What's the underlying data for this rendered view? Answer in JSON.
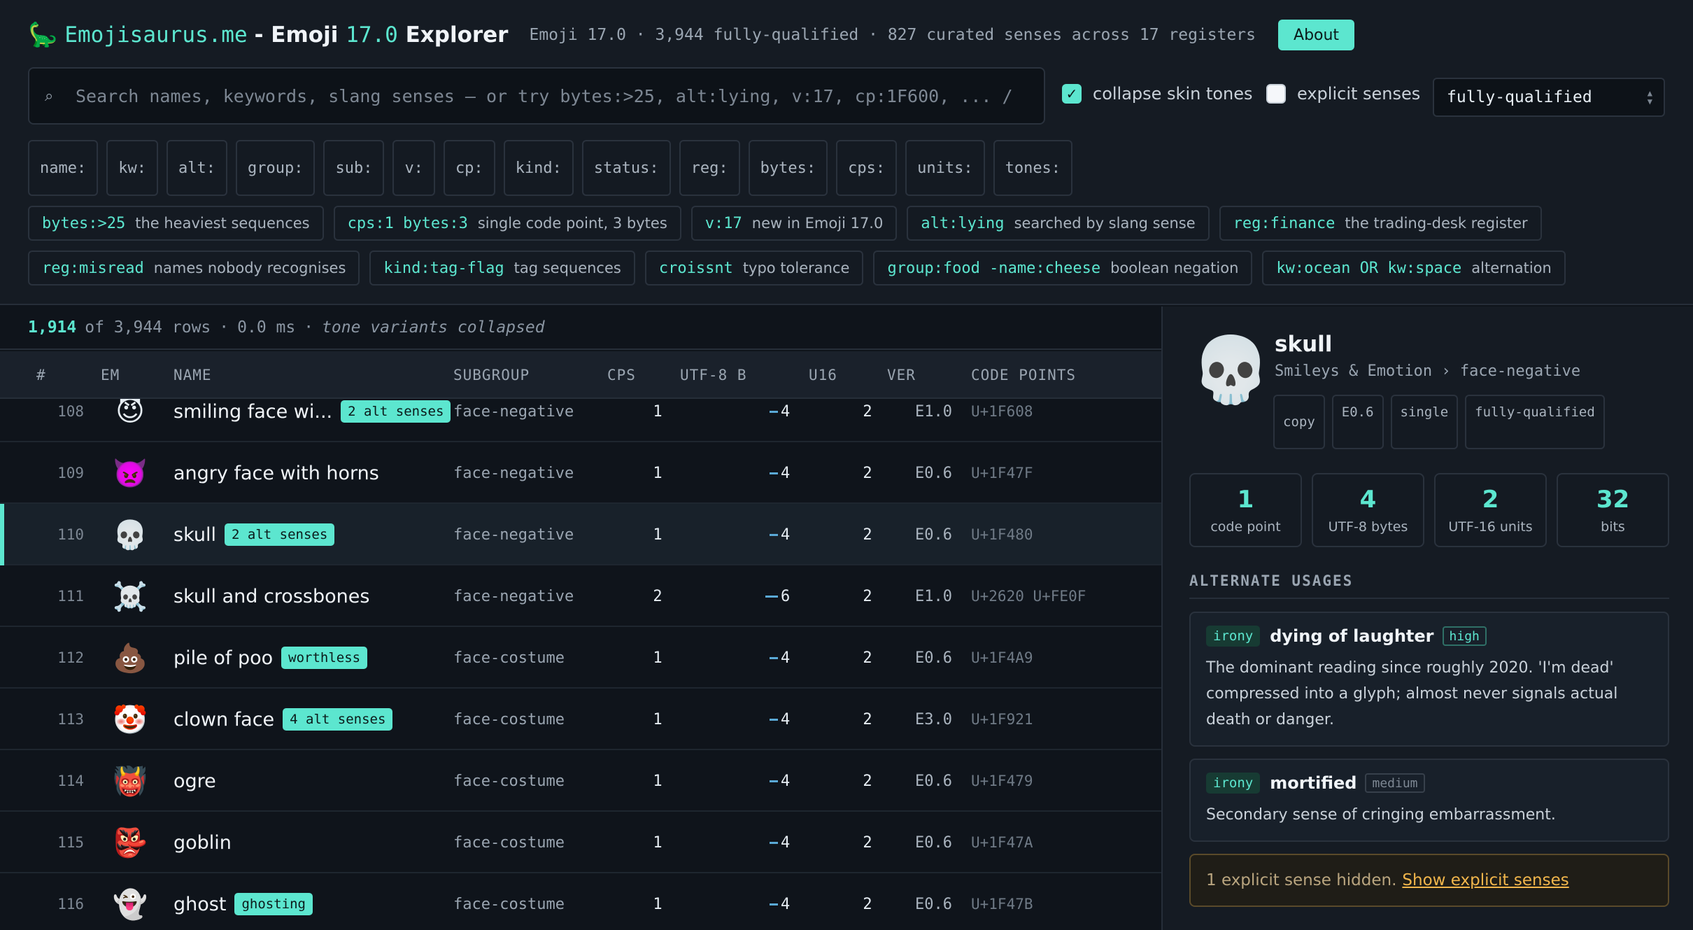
{
  "header": {
    "logo_icon": "🦕",
    "brand": "Emojisaurus.me",
    "title_sep": "- Emoji",
    "title_version": "17.0",
    "title_suffix": "Explorer",
    "meta": "Emoji 17.0 · 3,944 fully-qualified · 827 curated senses across 17 registers",
    "about_label": "About"
  },
  "search": {
    "icon": "search-icon",
    "placeholder": "Search names, keywords, slang senses — or try bytes:>25, alt:lying, v:17, cp:1F600, ... /",
    "value": ""
  },
  "options": {
    "collapse_label": "collapse skin tones",
    "collapse_checked": true,
    "explicit_label": "explicit senses",
    "explicit_checked": false,
    "status_select": "fully-qualified"
  },
  "field_chips": [
    "name:",
    "kw:",
    "alt:",
    "group:",
    "sub:",
    "v:",
    "cp:",
    "kind:",
    "status:",
    "reg:",
    "bytes:",
    "cps:",
    "units:",
    "tones:"
  ],
  "examples": [
    {
      "query": "bytes:>25",
      "desc": "the heaviest sequences"
    },
    {
      "query": "cps:1 bytes:3",
      "desc": "single code point, 3 bytes"
    },
    {
      "query": "v:17",
      "desc": "new in Emoji 17.0"
    },
    {
      "query": "alt:lying",
      "desc": "searched by slang sense"
    },
    {
      "query": "reg:finance",
      "desc": "the trading-desk register"
    },
    {
      "query": "reg:misread",
      "desc": "names nobody recognises"
    },
    {
      "query": "kind:tag-flag",
      "desc": "tag sequences"
    },
    {
      "query": "croissnt",
      "desc": "typo tolerance"
    },
    {
      "query": "group:food -name:cheese",
      "desc": "boolean negation"
    },
    {
      "query": "kw:ocean OR kw:space",
      "desc": "alternation"
    }
  ],
  "status": {
    "count": "1,914",
    "of_text": "of 3,944 rows",
    "time": "0.0 ms",
    "note": "tone variants collapsed"
  },
  "columns": {
    "num": "#",
    "em": "EM",
    "name": "NAME",
    "subgroup": "SUBGROUP",
    "cps": "CPS",
    "utf8": "UTF-8 B",
    "u16": "U16",
    "ver": "VER",
    "cp": "CODE POINTS"
  },
  "rows": [
    {
      "num": "108",
      "emoji": "😈",
      "name": "smiling face wi...",
      "badge": "2 alt senses",
      "subgroup": "face-negative",
      "cps": "1",
      "utf8": "4",
      "u16": "2",
      "ver": "E1.0",
      "cp": "U+1F608",
      "selected": false
    },
    {
      "num": "109",
      "emoji": "👿",
      "name": "angry face with horns",
      "badge": "",
      "subgroup": "face-negative",
      "cps": "1",
      "utf8": "4",
      "u16": "2",
      "ver": "E0.6",
      "cp": "U+1F47F",
      "selected": false
    },
    {
      "num": "110",
      "emoji": "💀",
      "name": "skull",
      "badge": "2 alt senses",
      "subgroup": "face-negative",
      "cps": "1",
      "utf8": "4",
      "u16": "2",
      "ver": "E0.6",
      "cp": "U+1F480",
      "selected": true
    },
    {
      "num": "111",
      "emoji": "☠️",
      "name": "skull and crossbones",
      "badge": "",
      "subgroup": "face-negative",
      "cps": "2",
      "utf8": "6",
      "u16": "2",
      "ver": "E1.0",
      "cp": "U+2620 U+FE0F",
      "selected": false
    },
    {
      "num": "112",
      "emoji": "💩",
      "name": "pile of poo",
      "badge": "worthless",
      "subgroup": "face-costume",
      "cps": "1",
      "utf8": "4",
      "u16": "2",
      "ver": "E0.6",
      "cp": "U+1F4A9",
      "selected": false
    },
    {
      "num": "113",
      "emoji": "🤡",
      "name": "clown face",
      "badge": "4 alt senses",
      "subgroup": "face-costume",
      "cps": "1",
      "utf8": "4",
      "u16": "2",
      "ver": "E3.0",
      "cp": "U+1F921",
      "selected": false
    },
    {
      "num": "114",
      "emoji": "👹",
      "name": "ogre",
      "badge": "",
      "subgroup": "face-costume",
      "cps": "1",
      "utf8": "4",
      "u16": "2",
      "ver": "E0.6",
      "cp": "U+1F479",
      "selected": false
    },
    {
      "num": "115",
      "emoji": "👺",
      "name": "goblin",
      "badge": "",
      "subgroup": "face-costume",
      "cps": "1",
      "utf8": "4",
      "u16": "2",
      "ver": "E0.6",
      "cp": "U+1F47A",
      "selected": false
    },
    {
      "num": "116",
      "emoji": "👻",
      "name": "ghost",
      "badge": "ghosting",
      "subgroup": "face-costume",
      "cps": "1",
      "utf8": "4",
      "u16": "2",
      "ver": "E0.6",
      "cp": "U+1F47B",
      "selected": false
    }
  ],
  "detail": {
    "emoji": "💀",
    "title": "skull",
    "breadcrumb": "Smileys & Emotion › face-negative",
    "copy_label": "copy",
    "tags": [
      "E0.6",
      "single",
      "fully-qualified"
    ],
    "stats": [
      {
        "value": "1",
        "label": "code point"
      },
      {
        "value": "4",
        "label": "UTF-8 bytes"
      },
      {
        "value": "2",
        "label": "UTF-16 units"
      },
      {
        "value": "32",
        "label": "bits"
      }
    ],
    "alt_heading": "ALTERNATE USAGES",
    "senses": [
      {
        "register": "irony",
        "name": "dying of laughter",
        "confidence": "high",
        "desc": "The dominant reading since roughly 2020. 'I'm dead' compressed into a glyph; almost never signals actual death or danger."
      },
      {
        "register": "irony",
        "name": "mortified",
        "confidence": "medium",
        "desc": "Secondary sense of cringing embarrassment."
      }
    ],
    "hidden_notice": "1 explicit sense hidden.",
    "show_link": "Show explicit senses"
  }
}
